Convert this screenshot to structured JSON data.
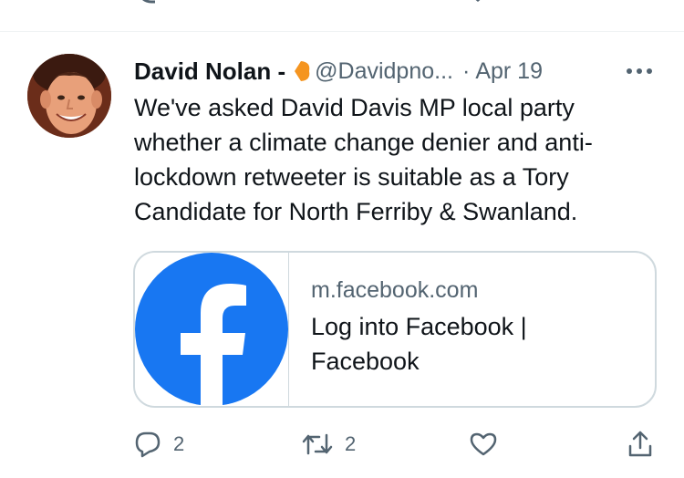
{
  "tweet": {
    "display_name": "David Nolan -",
    "handle": "@Davidpno...",
    "separator": "·",
    "date": "Apr 19",
    "text": "We've asked David Davis MP local party whether a climate change denier and anti-lockdown retweeter is suitable as a Tory Candidate for North Ferriby & Swanland.",
    "affiliation_icon": "orange-heart-badge-icon",
    "more_icon": "more-horizontal-icon"
  },
  "link_card": {
    "domain": "m.facebook.com",
    "title": "Log into Facebook | Facebook",
    "thumbnail_icon": "facebook-logo-icon",
    "brand_color": "#1877F2"
  },
  "actions": {
    "reply_count": "2",
    "retweet_count": "2",
    "like_count": "",
    "share_count": ""
  },
  "colors": {
    "text_primary": "#0f1419",
    "text_secondary": "#536471",
    "border": "#cfd9de"
  }
}
